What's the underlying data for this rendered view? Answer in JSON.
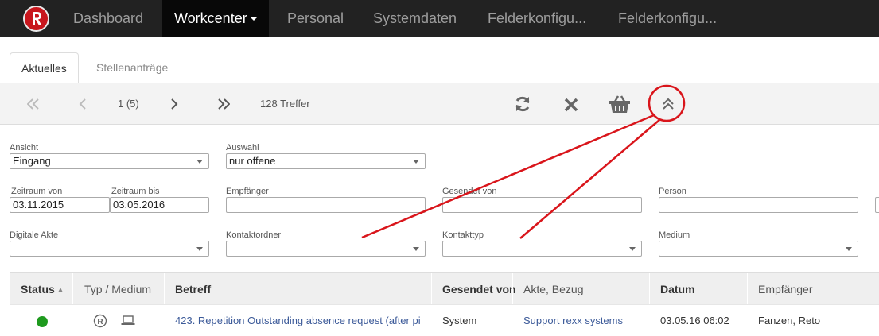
{
  "navbar": {
    "logo_icon": "rexx-logo-icon",
    "items": [
      {
        "label": "Dashboard"
      },
      {
        "label": "Workcenter"
      },
      {
        "label": "Personal"
      },
      {
        "label": "Systemdaten"
      },
      {
        "label": "Felderkonfigu..."
      },
      {
        "label": "Felderkonfigu..."
      }
    ],
    "active_color": "#080808"
  },
  "tabs": [
    {
      "label": "Aktuelles"
    },
    {
      "label": "Stellenanträge"
    }
  ],
  "toolbar": {
    "page": "1 (5)",
    "hits": "128 Treffer",
    "icons": [
      "first-page-icon",
      "prev-page-icon",
      "next-page-icon",
      "last-page-icon",
      "refresh-icon",
      "clear-icon",
      "basket-icon",
      "collapse-icon"
    ]
  },
  "filters": {
    "ansicht": {
      "label": "Ansicht",
      "value": "Eingang"
    },
    "auswahl": {
      "label": "Auswahl",
      "value": "nur offene"
    },
    "zeitraum_von": {
      "label": "Zeitraum von",
      "value": "03.11.2015"
    },
    "zeitraum_bis": {
      "label": "Zeitraum bis",
      "value": "03.05.2016"
    },
    "empfaenger": {
      "label": "Empfänger",
      "value": ""
    },
    "gesendet_von": {
      "label": "Gesendet von",
      "value": ""
    },
    "person": {
      "label": "Person",
      "value": ""
    },
    "digitale_akte": {
      "label": "Digitale Akte",
      "value": ""
    },
    "kontaktordner": {
      "label": "Kontaktordner",
      "value": ""
    },
    "kontakttyp": {
      "label": "Kontakttyp",
      "value": ""
    },
    "medium": {
      "label": "Medium",
      "value": ""
    }
  },
  "table": {
    "headers": [
      "Status",
      "Typ / Medium",
      "Betreff",
      "Gesendet von",
      "Akte, Bezug",
      "Datum",
      "Empfänger"
    ],
    "rows": [
      {
        "status_color": "#1e9a1e",
        "typ_icon": "registered-icon",
        "medium_icon": "laptop-icon",
        "betreff": "423. Repetition Outstanding absence request (after pi",
        "gesendet_von": "System",
        "akte": "Support rexx systems",
        "datum": "03.05.16 06:02",
        "empfaenger": "Fanzen, Reto"
      }
    ]
  },
  "annotation": {
    "color": "#d9151b"
  }
}
